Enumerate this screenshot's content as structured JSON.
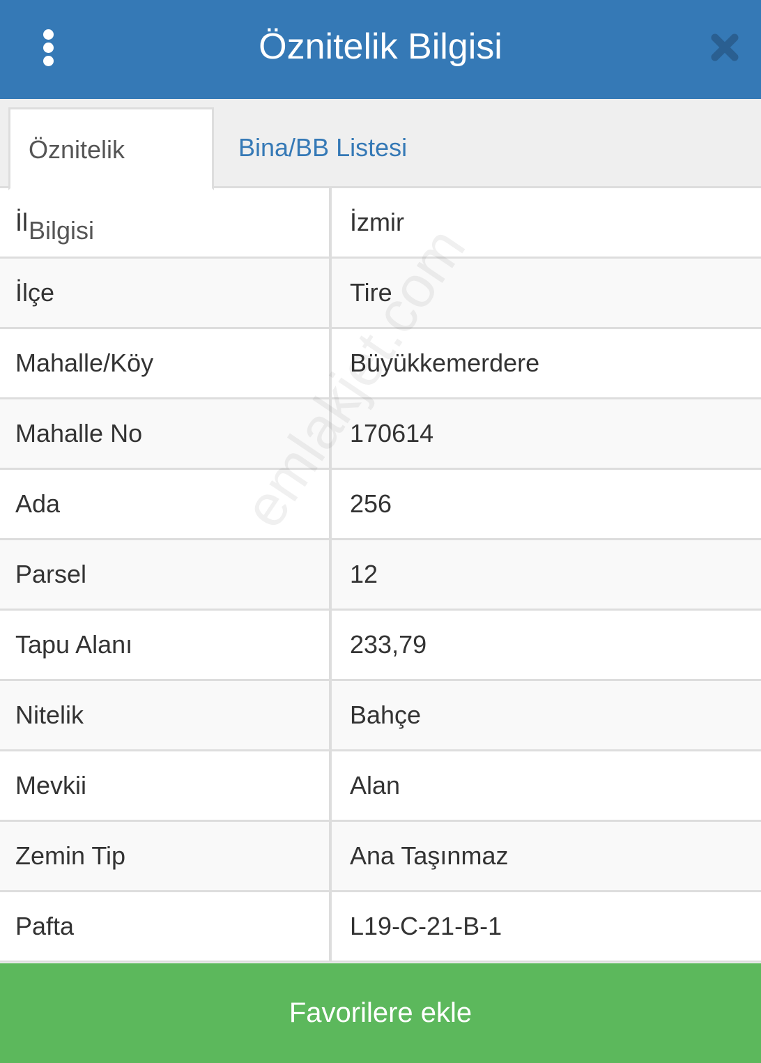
{
  "header": {
    "title": "Öznitelik Bilgisi",
    "menu_icon": "more-vertical-icon",
    "close_icon": "close-icon"
  },
  "tabs": [
    {
      "label": "Öznitelik Bilgisi",
      "active": true
    },
    {
      "label": "Bina/BB Listesi",
      "active": false
    }
  ],
  "rows": [
    {
      "key": "İl",
      "value": "İzmir"
    },
    {
      "key": "İlçe",
      "value": "Tire"
    },
    {
      "key": "Mahalle/Köy",
      "value": "Büyükkemerdere"
    },
    {
      "key": "Mahalle No",
      "value": "170614"
    },
    {
      "key": "Ada",
      "value": "256"
    },
    {
      "key": "Parsel",
      "value": "12"
    },
    {
      "key": "Tapu Alanı",
      "value": "233,79"
    },
    {
      "key": "Nitelik",
      "value": "Bahçe"
    },
    {
      "key": "Mevkii",
      "value": "Alan"
    },
    {
      "key": "Zemin Tip",
      "value": "Ana Taşınmaz"
    },
    {
      "key": "Pafta",
      "value": "L19-C-21-B-1"
    }
  ],
  "watermark": "emlakjet.com",
  "footer": {
    "button_label": "Favorilere ekle"
  },
  "colors": {
    "header_bg": "#3579b6",
    "tab_link": "#3579b6",
    "button_bg": "#5cb85c"
  }
}
